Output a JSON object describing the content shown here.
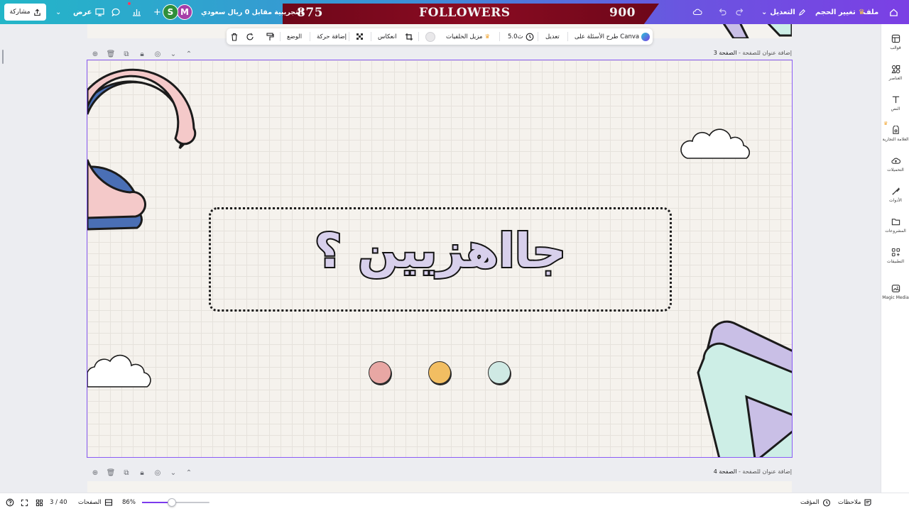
{
  "topbar": {
    "home_icon": "home-icon",
    "file_label": "ملف",
    "resize_label": "تغيير الحجم",
    "edit_label": "التعديل",
    "share_label": "مشاركة",
    "present_label": "عرض",
    "trial_text": "التجريبية مقابل 0 ريال سعودي",
    "avatars": [
      {
        "letter": "M",
        "color": "#a63ea8"
      },
      {
        "letter": "S",
        "color": "#2f8f3a"
      }
    ],
    "banner": {
      "left_number": "875",
      "title": "FOLLOWERS",
      "right_number": "900"
    }
  },
  "sidebar": {
    "items": [
      {
        "label": "قوالب",
        "icon": "templates-icon"
      },
      {
        "label": "العناصر",
        "icon": "elements-icon"
      },
      {
        "label": "النص",
        "icon": "text-icon"
      },
      {
        "label": "العلامة التجارية",
        "icon": "brand-icon"
      },
      {
        "label": "التحميلات",
        "icon": "uploads-icon"
      },
      {
        "label": "الأدوات",
        "icon": "tools-icon"
      },
      {
        "label": "المشروعات",
        "icon": "projects-icon"
      },
      {
        "label": "التطبيقات",
        "icon": "apps-icon"
      },
      {
        "label": "Magic Media",
        "icon": "magic-media-icon"
      }
    ]
  },
  "toolbar": {
    "ask_canva": "طرح الأسئلة على Canva",
    "edit": "تعديل",
    "duration": "5.0ث",
    "bg_remover": "مزيل الخلفيات",
    "flip": "انعكاس",
    "animate": "إضافة حركة",
    "position": "الوضع"
  },
  "pages": {
    "current": {
      "label": "الصفحة 3",
      "title_placeholder": "إضافة عنوان للصفحة"
    },
    "next": {
      "label": "الصفحة 4",
      "title_placeholder": "إضافة عنوان للصفحة"
    }
  },
  "design": {
    "title": "جااهزيين ؟",
    "dots": [
      {
        "color": "#e8a7a4"
      },
      {
        "color": "#f2be62"
      },
      {
        "color": "#cfe9e4"
      }
    ],
    "colors": {
      "pink": "#f4c9c9",
      "blue": "#4a6fb5",
      "lavender": "#c9bfe6",
      "mint": "#cdeee6",
      "border": "#8b5cf6"
    }
  },
  "bottombar": {
    "notes": "ملاحظات",
    "timer": "المؤقت",
    "zoom": "86%",
    "pages_label": "الصفحات",
    "page_counter": "3 / 40"
  }
}
